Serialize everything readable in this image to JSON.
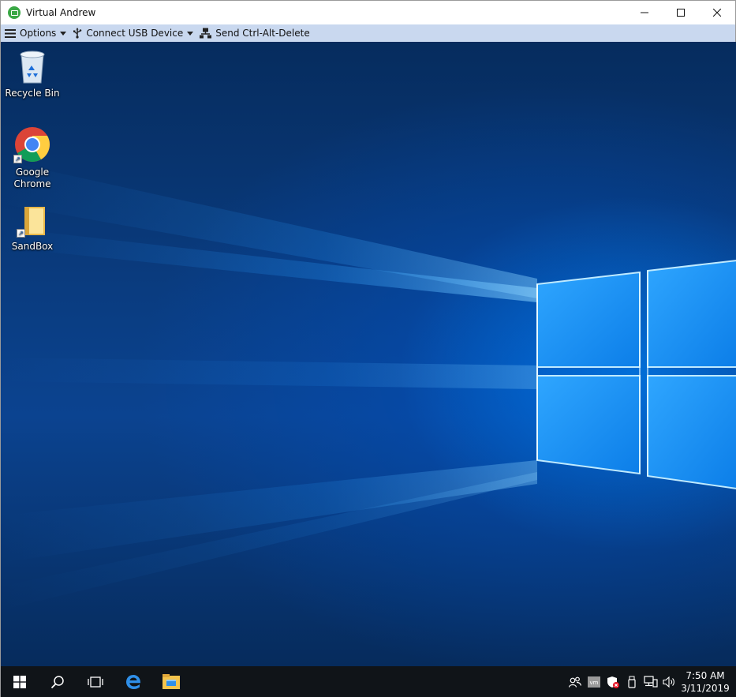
{
  "window": {
    "title": "Virtual Andrew",
    "controls": [
      "minimize",
      "maximize",
      "close"
    ]
  },
  "toolbar": {
    "options_label": "Options",
    "usb_label": "Connect USB Device",
    "cad_label": "Send Ctrl-Alt-Delete"
  },
  "desktop": {
    "icons": [
      {
        "label": "Recycle Bin",
        "icon": "recycle-bin-icon"
      },
      {
        "label": "Google Chrome",
        "icon": "chrome-icon",
        "shortcut": true
      },
      {
        "label": "SandBox",
        "icon": "folder-icon",
        "shortcut": true
      }
    ]
  },
  "taskbar": {
    "apps": [
      "start-icon",
      "search-icon",
      "task-view-icon",
      "edge-icon",
      "file-explorer-icon"
    ],
    "tray": [
      "people-icon",
      "vmware-icon",
      "defender-icon",
      "usb-icon",
      "network-icon",
      "volume-icon"
    ],
    "time": "7:50 AM",
    "date": "3/11/2019"
  },
  "colors": {
    "toolbar_bg": "#c9d8ef",
    "taskbar_bg": "#101418",
    "desktop_blue": "#0a3c80",
    "accent": "#0078d7"
  }
}
